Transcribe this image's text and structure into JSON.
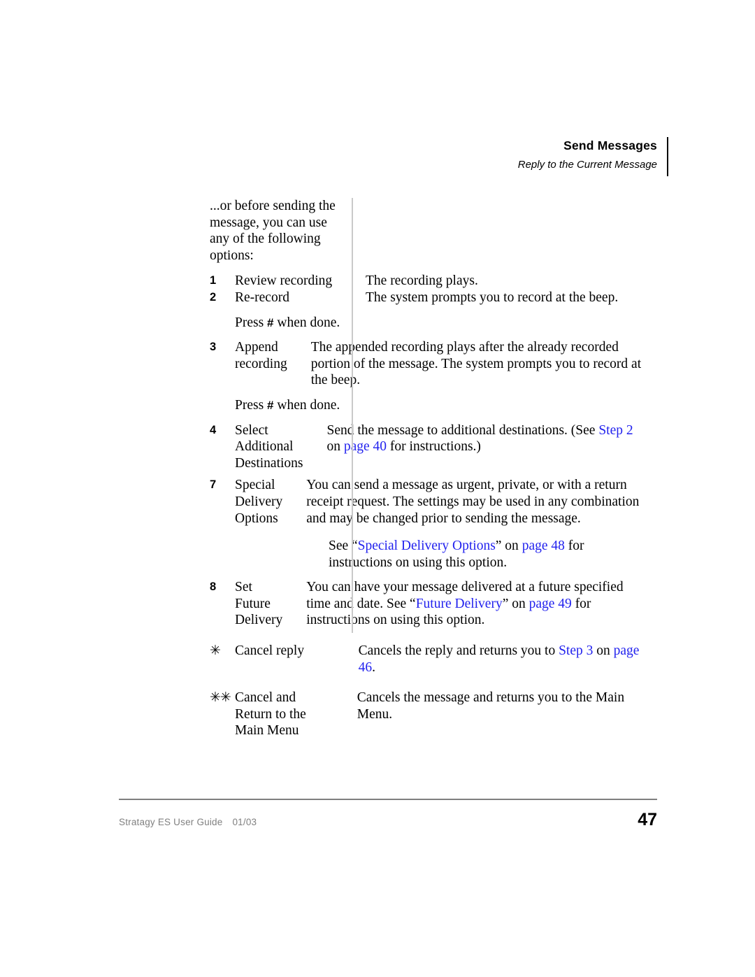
{
  "header": {
    "title": "Send Messages",
    "subtitle": "Reply to the Current Message"
  },
  "body": {
    "intro": "...or before sending the message, you can use any of the following options:",
    "rows": [
      {
        "key": "1",
        "label": "Review recording",
        "desc_plain": "The recording plays."
      },
      {
        "key": "2",
        "label": "Re-record",
        "desc_plain": "The system prompts you to record at the beep.",
        "note_prefix": "Press ",
        "note_key": "#",
        "note_suffix": " when done."
      },
      {
        "key": "3",
        "label": "Append recording",
        "desc_plain": "The appended recording plays after the already recorded portion of the message. The system prompts you to record at the beep.",
        "note_prefix": "Press ",
        "note_key": "#",
        "note_suffix": " when done."
      },
      {
        "key": "4",
        "label": "Select Additional Destinations",
        "desc_part1": "Send the message to additional destinations. (See ",
        "desc_link1": "Step 2",
        "desc_part2": " on ",
        "desc_link2": "page 40",
        "desc_part3": " for instructions.)"
      },
      {
        "key": "7",
        "label": "Special Delivery Options",
        "desc_plain": "You can send a message as urgent, private, or with a return receipt request. The settings may be used in any combination and may be changed prior to sending the message.",
        "desc2_part1": "See “",
        "desc2_link1": "Special Delivery Options",
        "desc2_part2": "” on ",
        "desc2_link2": "page 48",
        "desc2_part3": " for instructions on using this option."
      },
      {
        "key": "8",
        "label": "Set Future Delivery",
        "desc_part1": "You can have your message delivered at a future specified time and date. See “",
        "desc_link1": "Future Delivery",
        "desc_part2": "” on ",
        "desc_link2": "page 49",
        "desc_part3": " for instructions on using this option."
      },
      {
        "key": "✳",
        "label": "Cancel reply",
        "desc_part1": "Cancels the reply and returns you to ",
        "desc_link1": "Step 3",
        "desc_part2": " on ",
        "desc_link2": "page 46",
        "desc_part3": "."
      },
      {
        "key": "✳✳",
        "label": "Cancel and Return to the Main Menu",
        "desc_plain": "Cancels the message and returns you to the Main Menu."
      }
    ]
  },
  "footer": {
    "guide": "Stratagy ES User Guide",
    "date": "01/03",
    "page_number": "47"
  },
  "colors": {
    "link": "#2222ee",
    "footer_text": "#808080",
    "rule": "#7f7f7f",
    "divider": "#c9c9c9"
  }
}
